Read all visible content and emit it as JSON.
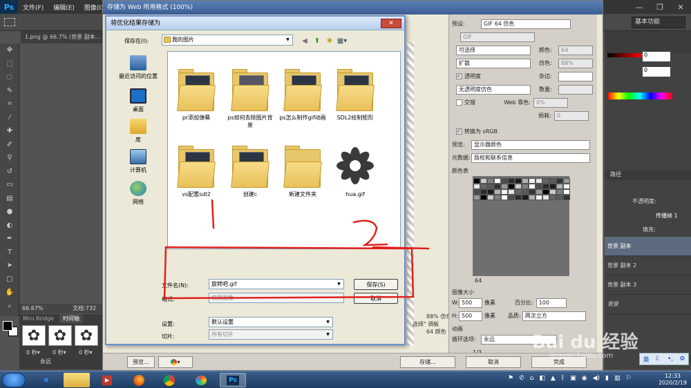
{
  "ps": {
    "logo": "Ps",
    "menus": [
      "文件(F)",
      "编辑(E)",
      "图像(I)"
    ],
    "workspace": "基本功能",
    "doc_tab": "1.png @ 66.7% (背景 副本...",
    "zoom_status": "66.67%",
    "doc_status": "文档:732",
    "bottom_tabs": [
      "Mini Bridge",
      "时间轴"
    ],
    "frame_time": "0 秒▾",
    "loop": "永远",
    "layers_tab": "路径",
    "opacity_label": "不透明度:",
    "fill_label": "填充:",
    "propagate": "传播帧 1",
    "layers": [
      "背景 副本",
      "背景 副本 2",
      "背景 副本 3",
      "背景"
    ]
  },
  "sfw": {
    "title": "存储为 Web 所用格式 (100%)",
    "preset_label": "预设:",
    "preset_value": "GIF 64 仿色",
    "format": "GIF",
    "reduction": "可选择",
    "dither_algo": "扩散",
    "colors_label": "颜色:",
    "colors_value": "64",
    "dither_label": "仿色:",
    "dither_value": "88%",
    "transparency": "透明度",
    "matte_label": "杂边:",
    "trans_dither": "无透明度仿色",
    "amount_label": "数量:",
    "interlaced": "交错",
    "web_snap_label": "Web 靠色:",
    "web_snap_value": "0%",
    "lossy_label": "损耗:",
    "lossy_value": "0",
    "convert_srgb": "转换为 sRGB",
    "preview_label": "预览:",
    "preview_value": "显示器颜色",
    "metadata_label": "元数据:",
    "metadata_value": "版权和联系信息",
    "color_table_title": "颜色表",
    "color_count": "64",
    "image_size_title": "图像大小",
    "w_label": "W:",
    "w_value": "500",
    "h_label": "H:",
    "h_value": "500",
    "unit": "像素",
    "percent_label": "百分比:",
    "percent_value": "100",
    "quality_label": "品质:",
    "quality_value": "两次立方",
    "anim_title": "动画",
    "loop_label": "循环选项:",
    "loop_value": "永远",
    "frame_counter": "1/3",
    "info_line1": "88% 仿色",
    "info_line2": "选择\" 调板",
    "info_line3": "64 颜色",
    "preview_btn": "预览...",
    "save_btn": "存储...",
    "cancel_btn": "取消",
    "done_btn": "完成"
  },
  "dialog": {
    "title": "将优化结果存储为",
    "save_in_label": "保存在(I):",
    "save_in_value": "我的图片",
    "places": [
      "最近访问的位置",
      "桌面",
      "库",
      "计算机",
      "网络"
    ],
    "files": [
      {
        "name": "pr添加弹幕",
        "type": "folder"
      },
      {
        "name": "ps如何去除图片背景",
        "type": "folder"
      },
      {
        "name": "ps怎么制作gif动画",
        "type": "folder"
      },
      {
        "name": "SDL2绘制矩形",
        "type": "folder"
      },
      {
        "name": "vs配置sdl2",
        "type": "folder"
      },
      {
        "name": "创建c",
        "type": "folder"
      },
      {
        "name": "新建文件夹",
        "type": "folder"
      },
      {
        "name": "hua.gif",
        "type": "gif"
      }
    ],
    "filename_label": "文件名(N):",
    "filename_value": "旋转吧.gif",
    "format_label": "格式:",
    "format_value": "仅限图像",
    "settings_label": "设置:",
    "settings_value": "默认设置",
    "slices_label": "切片:",
    "slices_value": "所有切片",
    "save_button": "保存(S)",
    "cancel_button": "取消"
  },
  "taskbar": {
    "time": "12:33",
    "date": "2020/2/19",
    "ime": "英"
  },
  "watermark": {
    "brand": "Bai du 经验",
    "url": "jingyan.baidu.com"
  },
  "colors": {
    "ps_dark": "#353535",
    "annot_red": "#e0201d",
    "xp_title": "#3c5f96",
    "selected_layer": "#5d6b80"
  }
}
